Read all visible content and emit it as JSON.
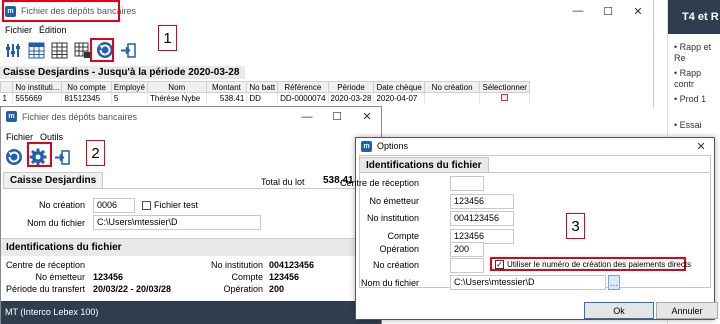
{
  "back_window": {
    "title": "Fichier des dépôts bancaires",
    "menu": [
      "Fichier",
      "Édition"
    ],
    "heading": "Caisse Desjardins - Jusqu'à la période 2020-03-28",
    "columns": [
      "",
      "No instituti...",
      "No compte",
      "Employé",
      "Nom",
      "Montant",
      "No batt",
      "Référence",
      "Période",
      "Date chèque",
      "No création",
      "Sélectionner"
    ],
    "row": [
      "1",
      "555669",
      "81512345",
      "5",
      "Thérèse Nybe",
      "538.41",
      "DD",
      "DD-0000074",
      "2020-03-28",
      "2020-04-07",
      "",
      ""
    ]
  },
  "help_panel": {
    "title": "T4 et R",
    "items": [
      "Rapp et Re",
      "Rapp contr",
      "Prod 1",
      "Essai"
    ]
  },
  "mid_window": {
    "title": "Fichier des dépôts bancaires",
    "menu": [
      "Fichier",
      "Outils"
    ],
    "tab": "Caisse Desjardins",
    "total_label": "Total du lot",
    "total_value": "538,41",
    "no_creation_label": "No création",
    "no_creation_value": "0006",
    "fichier_test_label": "Fichier test",
    "nom_fichier_label": "Nom du fichier",
    "nom_fichier_value": "C:\\Users\\mtessier\\D",
    "ident_heading": "Identifications du fichier",
    "centre_label": "Centre de réception",
    "no_emetteur_label": "No émetteur",
    "no_emetteur_value": "123456",
    "periode_label": "Période du transfert",
    "periode_value": "20/03/22 - 20/03/28",
    "no_institution_label": "No institution",
    "no_institution_value": "004123456",
    "compte_label": "Compte",
    "compte_value": "123456",
    "operation_label": "Opération",
    "operation_value": "200",
    "status": "MT (Interco Lebex 100)"
  },
  "options_dialog": {
    "title": "Options",
    "tab": "Identifications du fichier",
    "fields": [
      {
        "label": "Centre de réception",
        "value": ""
      },
      {
        "label": "No émetteur",
        "value": "123456"
      },
      {
        "label": "No institution",
        "value": "004123456"
      },
      {
        "label": "Compte",
        "value": "123456"
      },
      {
        "label": "Opération",
        "value": "200"
      },
      {
        "label": "No création",
        "value": ""
      },
      {
        "label": "Nom du fichier",
        "value": "C:\\Users\\mtessier\\D"
      }
    ],
    "checkbox_label": "Utiliser le numéro de création des paiements directs",
    "browse_label": "...",
    "ok_label": "Ok",
    "cancel_label": "Annuler"
  },
  "callouts": [
    "1",
    "2",
    "3"
  ],
  "colors": {
    "highlight": "#e3001b",
    "icon_blue": "#1f5fae",
    "header_bg": "#f0f0f0"
  }
}
